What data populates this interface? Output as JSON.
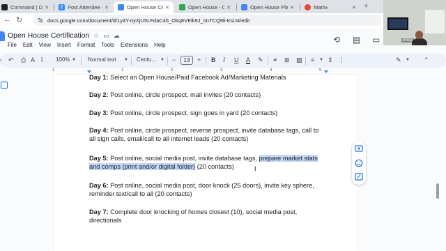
{
  "browser": {
    "tabs": [
      {
        "title": "Command | Dashbo",
        "fav_color": "#202124",
        "fav_glyph": ""
      },
      {
        "title": "Post Attendee - Zo",
        "fav_color": "#2d8cff",
        "fav_glyph": "Z"
      },
      {
        "title": "Open House Certifi",
        "fav_color": "#4285f4",
        "fav_glyph": "",
        "active": true
      },
      {
        "title": "Open House - Goo",
        "fav_color": "#34a853",
        "fav_glyph": ""
      },
      {
        "title": "Open House Playb",
        "fav_color": "#4285f4",
        "fav_glyph": ""
      },
      {
        "title": "Matrix",
        "fav_color": "#ea4335",
        "fav_glyph": ""
      }
    ],
    "url": "docs.google.com/document/d/1y4Y-oyXjU5LFdaC46_Okq8VElk9J_0nTCQ9li-KsiJ4/edit"
  },
  "doc": {
    "title": "Open House Certification",
    "menu": [
      "File",
      "Edit",
      "View",
      "Insert",
      "Format",
      "Tools",
      "Extensions",
      "Help"
    ]
  },
  "toolbar": {
    "zoom": "100%",
    "style": "Normal text",
    "font": "Centu...",
    "font_size": "13",
    "minus": "−",
    "plus": "+"
  },
  "ruler": {
    "marks": [
      "1",
      "1",
      "2",
      "3",
      "4",
      "5"
    ]
  },
  "content": {
    "day1": {
      "label": "Day 1:",
      "text": " Select an Open House/Paid Facebook Ad/Marketing Materials"
    },
    "day2": {
      "label": "Day 2:",
      "text": " Post online, circle prospect, mail invites (20 contacts)"
    },
    "day3": {
      "label": "Day 3:",
      "text": " Post online, circle prospect, sign goes in yard (20 contacts)"
    },
    "day4": {
      "label": "Day 4:",
      "text": " Post online, circle prospect, reverse prospect, invite database tags, call to all sign calls, email/call to all internet leads (20 contacts)"
    },
    "day5": {
      "label": "Day 5:",
      "text_before": " Post online, social media post, invite database tags, ",
      "highlighted": "prepare market stats and comps (print and/or digital folder)",
      "text_after": " (20 contacts)"
    },
    "day6": {
      "label": "Day 6:",
      "text": " Post online, social media post, door knock (25 doors), invite key sphere, reminder text/call to all (20 contacts)"
    },
    "day7": {
      "label": "Day 7:",
      "text": " Complete door knocking of homes closest (10), social media post, directionals"
    }
  },
  "webcam": {
    "name": "Erica"
  }
}
